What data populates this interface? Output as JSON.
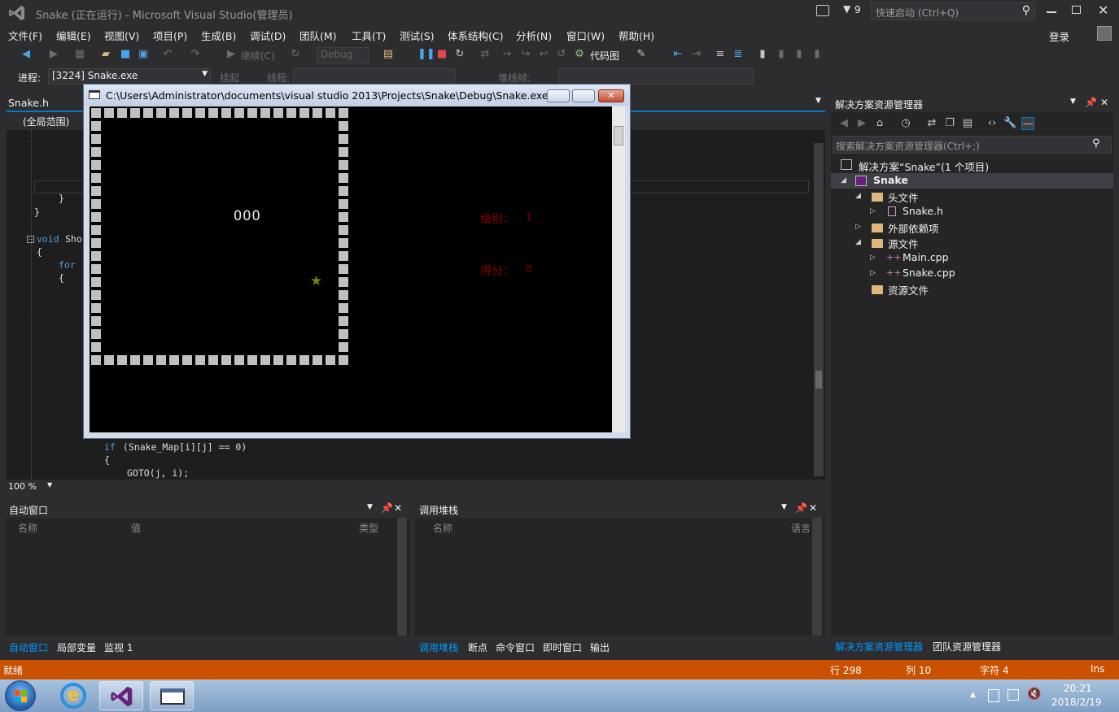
{
  "window": {
    "title": "Snake (正在运行) - Microsoft Visual Studio(管理员)",
    "notify_count": "9",
    "quick_launch_placeholder": "快速启动 (Ctrl+Q)",
    "login": "登录"
  },
  "menu": [
    "文件(F)",
    "编辑(E)",
    "视图(V)",
    "项目(P)",
    "生成(B)",
    "调试(D)",
    "团队(M)",
    "工具(T)",
    "测试(S)",
    "体系结构(C)",
    "分析(N)",
    "窗口(W)",
    "帮助(H)"
  ],
  "toolbar": {
    "continue": "继续(C)",
    "config": "Debug",
    "code_map": "代码图"
  },
  "debug_bar": {
    "process_label": "进程:",
    "process_value": "[3224] Snake.exe",
    "suspend": "挂起",
    "thread": "线程:",
    "stack_frame": "堆栈帧:"
  },
  "editor": {
    "tab": "Snake.h",
    "scope": "(全局范围)",
    "zoom": "100 %",
    "lines": {
      "brace1": "}",
      "brace2": "}",
      "void_kw": "void",
      "void_name": "Sho",
      "open1": "{",
      "for_kw": "for",
      "open2": "{",
      "if_kw": "if",
      "if_rest": " (Snake_Map[i][j] == 0)",
      "open3": "{",
      "goto": "GOTO(j, i);"
    }
  },
  "console": {
    "title": "C:\\Users\\Administrator\\documents\\visual studio 2013\\Projects\\Snake\\Debug\\Snake.exe",
    "snake": "OOO",
    "food": "★",
    "level_label": "级别：",
    "level_value": "1",
    "score_label": "得分：",
    "score_value": "0"
  },
  "solution_explorer": {
    "title": "解决方案资源管理器",
    "search_placeholder": "搜索解决方案资源管理器(Ctrl+;)",
    "solution": "解决方案“Snake”(1 个项目)",
    "project": "Snake",
    "headers": "头文件",
    "snake_h": "Snake.h",
    "external": "外部依赖项",
    "sources": "源文件",
    "main_cpp": "Main.cpp",
    "snake_cpp": "Snake.cpp",
    "resources": "资源文件",
    "tabs": [
      "解决方案资源管理器",
      "团队资源管理器"
    ]
  },
  "autos": {
    "title": "自动窗口",
    "cols": [
      "名称",
      "值",
      "类型"
    ],
    "tabs": [
      "自动窗口",
      "局部变量",
      "监视 1"
    ]
  },
  "callstack": {
    "title": "调用堆栈",
    "cols": [
      "名称",
      "语言"
    ],
    "tabs": [
      "调用堆栈",
      "断点",
      "命令窗口",
      "即时窗口",
      "输出"
    ]
  },
  "status": {
    "ready": "就绪",
    "line": "行 298",
    "col": "列 10",
    "char": "字符 4",
    "mode": "Ins"
  },
  "taskbar": {
    "time": "20:21",
    "date": "2018/2/19"
  },
  "colors": {
    "accent": "#007acc",
    "status": "#ca5100",
    "wall": "#c0c0c0",
    "text_red": "#8b0000",
    "food": "#808000"
  }
}
